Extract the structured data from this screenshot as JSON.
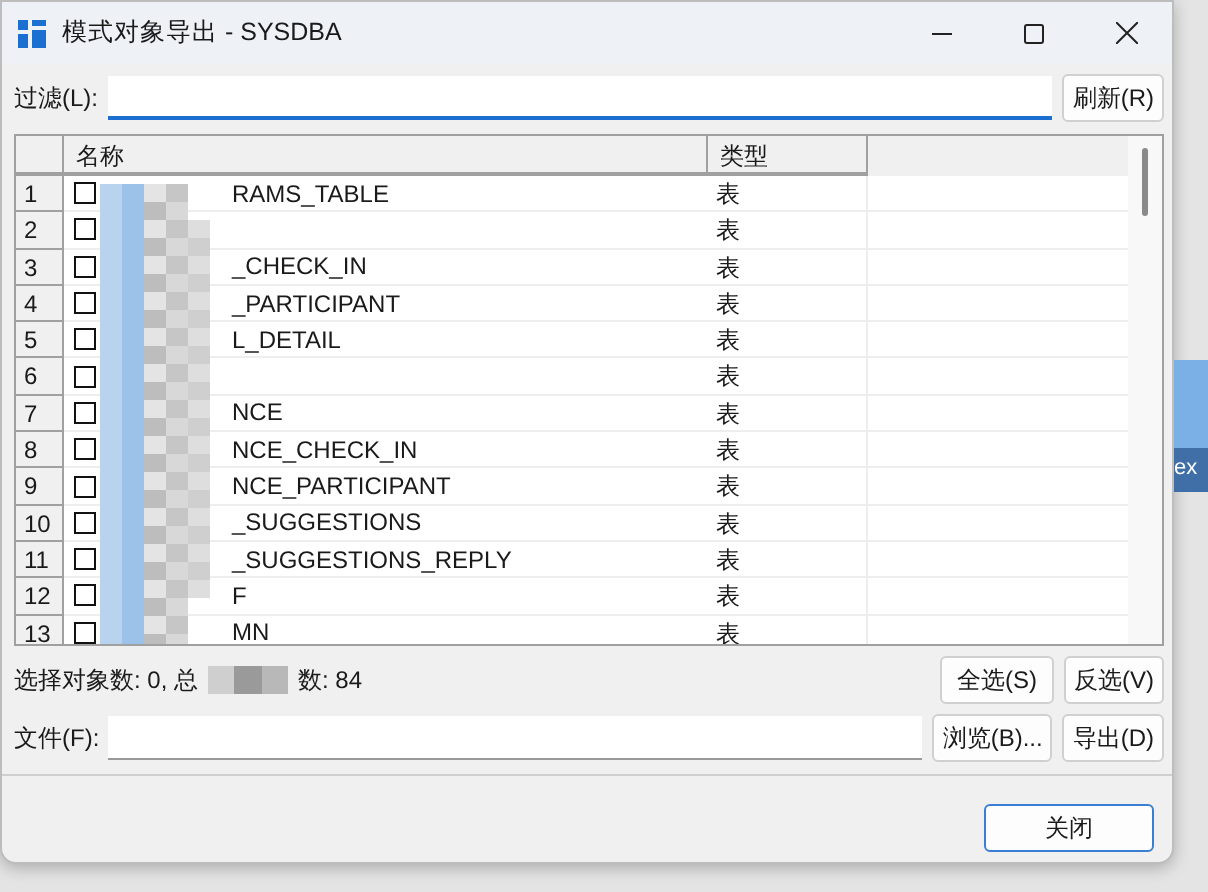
{
  "window": {
    "title": "模式对象导出 - SYSDBA"
  },
  "filter": {
    "label": "过滤(L):",
    "refresh_button": "刷新(R)"
  },
  "table": {
    "columns": [
      "名称",
      "类型"
    ],
    "rows": [
      {
        "number": "1",
        "checked": false,
        "name": "RAMS_TABLE",
        "type": "表"
      },
      {
        "number": "2",
        "checked": false,
        "type": "表"
      },
      {
        "number": "3",
        "checked": false,
        "name": "_CHECK_IN",
        "type": "表"
      },
      {
        "number": "4",
        "checked": false,
        "name": "_PARTICIPANT",
        "type": "表"
      },
      {
        "number": "5",
        "checked": false,
        "name": "L_DETAIL",
        "type": "表"
      },
      {
        "number": "6",
        "checked": false,
        "type": "表"
      },
      {
        "number": "7",
        "checked": false,
        "name": "NCE",
        "type": "表"
      },
      {
        "number": "8",
        "checked": false,
        "name": "NCE_CHECK_IN",
        "type": "表"
      },
      {
        "number": "9",
        "checked": false,
        "name": "NCE_PARTICIPANT",
        "type": "表"
      },
      {
        "number": "10",
        "checked": false,
        "name": "_SUGGESTIONS",
        "type": "表"
      },
      {
        "number": "11",
        "checked": false,
        "name": "_SUGGESTIONS_REPLY",
        "type": "表"
      },
      {
        "number": "12",
        "checked": false,
        "name": "F",
        "type": "表"
      },
      {
        "number": "13",
        "checked": false,
        "name": "MN",
        "type": "表"
      }
    ]
  },
  "status": {
    "selected_text": "选择对象数: 0, 总",
    "total_text": "数: 84",
    "select_all_button": "全选(S)",
    "invert_button": "反选(V)"
  },
  "file": {
    "label": "文件(F):",
    "browse_button": "浏览(B)...",
    "export_button": "导出(D)"
  },
  "close_button": "关闭",
  "background": {
    "fragment": "ex"
  }
}
